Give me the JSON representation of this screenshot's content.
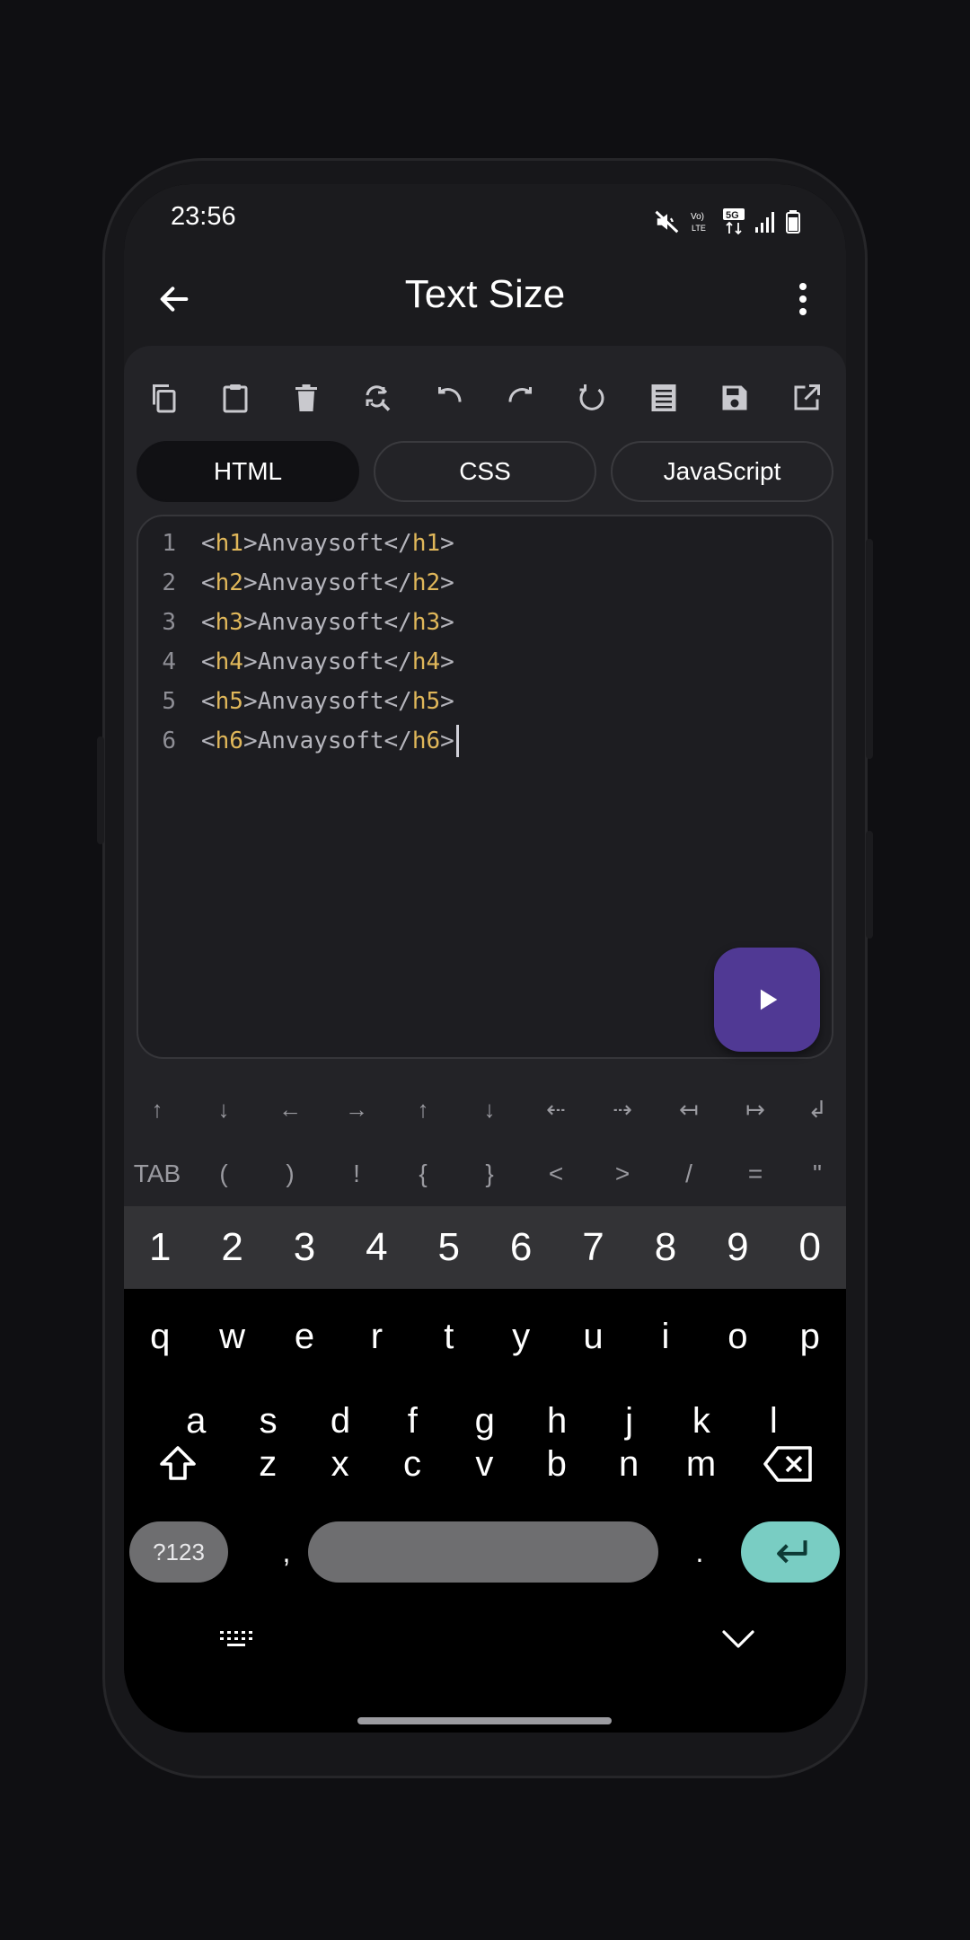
{
  "status_bar": {
    "time": "23:56",
    "icons": [
      "mute-icon",
      "volte-icon",
      "5g-icon",
      "signal-icon",
      "battery-icon"
    ]
  },
  "app_bar": {
    "title": "Text Size",
    "back_icon": "arrow-left-icon",
    "more_icon": "more-vert-icon"
  },
  "toolbar": {
    "tools": [
      "copy-icon",
      "paste-icon",
      "delete-icon",
      "find-replace-icon",
      "undo-icon",
      "redo-icon",
      "refresh-icon",
      "format-icon",
      "save-icon",
      "open-external-icon"
    ]
  },
  "tabs": [
    {
      "label": "HTML",
      "active": true
    },
    {
      "label": "CSS",
      "active": false
    },
    {
      "label": "JavaScript",
      "active": false
    }
  ],
  "editor": {
    "lines": [
      {
        "num": "1",
        "tag_open": "h1",
        "text": "Anvaysoft",
        "tag_close": "h1"
      },
      {
        "num": "2",
        "tag_open": "h2",
        "text": "Anvaysoft",
        "tag_close": "h2"
      },
      {
        "num": "3",
        "tag_open": "h3",
        "text": "Anvaysoft",
        "tag_close": "h3"
      },
      {
        "num": "4",
        "tag_open": "h4",
        "text": "Anvaysoft",
        "tag_close": "h4"
      },
      {
        "num": "5",
        "tag_open": "h5",
        "text": "Anvaysoft",
        "tag_close": "h5"
      },
      {
        "num": "6",
        "tag_open": "h6",
        "text": "Anvaysoft",
        "tag_close": "h6"
      }
    ],
    "syntax": {
      "lt": "<",
      "gt": ">",
      "lt_slash": "</"
    },
    "run_icon": "play-icon"
  },
  "symbol_bar": {
    "row1": [
      "↑",
      "↓",
      "←",
      "→",
      "↑",
      "↓",
      "⇠",
      "⇢",
      "↤",
      "↦",
      "↲"
    ],
    "row2": [
      "TAB",
      "(",
      ")",
      "!",
      "{",
      "}",
      "<",
      ">",
      "/",
      "=",
      "\""
    ]
  },
  "keyboard": {
    "numbers": [
      "1",
      "2",
      "3",
      "4",
      "5",
      "6",
      "7",
      "8",
      "9",
      "0"
    ],
    "row1": [
      "q",
      "w",
      "e",
      "r",
      "t",
      "y",
      "u",
      "i",
      "o",
      "p"
    ],
    "row2": [
      "a",
      "s",
      "d",
      "f",
      "g",
      "h",
      "j",
      "k",
      "l"
    ],
    "row3": [
      "z",
      "x",
      "c",
      "v",
      "b",
      "n",
      "m"
    ],
    "sym_key": "?123",
    "comma": ",",
    "period": ".",
    "enter_icon": "enter-icon",
    "shift_icon": "shift-icon",
    "backspace_icon": "backspace-icon",
    "toggle_icon": "keyboard-toggle-icon",
    "hide_icon": "chevron-down-icon"
  },
  "colors": {
    "accent": "#503994",
    "tag": "#e0b75a",
    "enter_key": "#79cdc3"
  }
}
